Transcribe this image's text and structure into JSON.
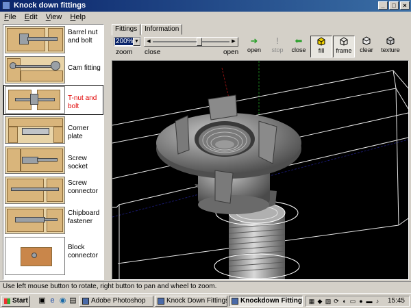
{
  "window": {
    "title": "Knock down fittings",
    "buttons": [
      "_",
      "□",
      "×"
    ]
  },
  "menu": [
    {
      "key": "F",
      "rest": "ile"
    },
    {
      "key": "E",
      "rest": "dit"
    },
    {
      "key": "V",
      "rest": "iew"
    },
    {
      "key": "H",
      "rest": "elp"
    }
  ],
  "fittings": [
    {
      "label": "Barrel nut and bolt",
      "selected": false
    },
    {
      "label": "Cam fitting",
      "selected": false
    },
    {
      "label": "T-nut and bolt",
      "selected": true
    },
    {
      "label": "Corner plate",
      "selected": false
    },
    {
      "label": "Screw socket",
      "selected": false
    },
    {
      "label": "Screw connector",
      "selected": false
    },
    {
      "label": "Chipboard fastener",
      "selected": false
    },
    {
      "label": "Block connector",
      "selected": false
    }
  ],
  "tabs": [
    {
      "label": "Fittings",
      "active": true
    },
    {
      "label": "Information",
      "active": false
    }
  ],
  "toolbar": {
    "zoom_value": "200%",
    "zoom_label": "zoom",
    "slider_close_label": "close",
    "slider_open_label": "open",
    "slider_position": 0.62,
    "open_label": "open",
    "stop_label": "stop",
    "close_label": "close",
    "fill_label": "fill",
    "frame_label": "frame",
    "clear_label": "clear",
    "texture_label": "texture"
  },
  "status_text": "Use left mouse button to rotate, right button to pan and wheel to zoom.",
  "taskbar": {
    "start_label": "Start",
    "tasks": [
      {
        "label": "Adobe Photoshop",
        "active": false
      },
      {
        "label": "Knock Down Fittings",
        "active": false
      },
      {
        "label": "Knockdown Fittings",
        "active": true
      }
    ],
    "clock": "15:45"
  },
  "colors": {
    "titlebar": "#0a246a",
    "selected_label": "#e00000",
    "viewport_bg": "#000000",
    "wood": "#d9b57b",
    "open_arrow": "#2aa02a",
    "close_arrow": "#2aa02a",
    "fill_icon": "#f0d000"
  }
}
